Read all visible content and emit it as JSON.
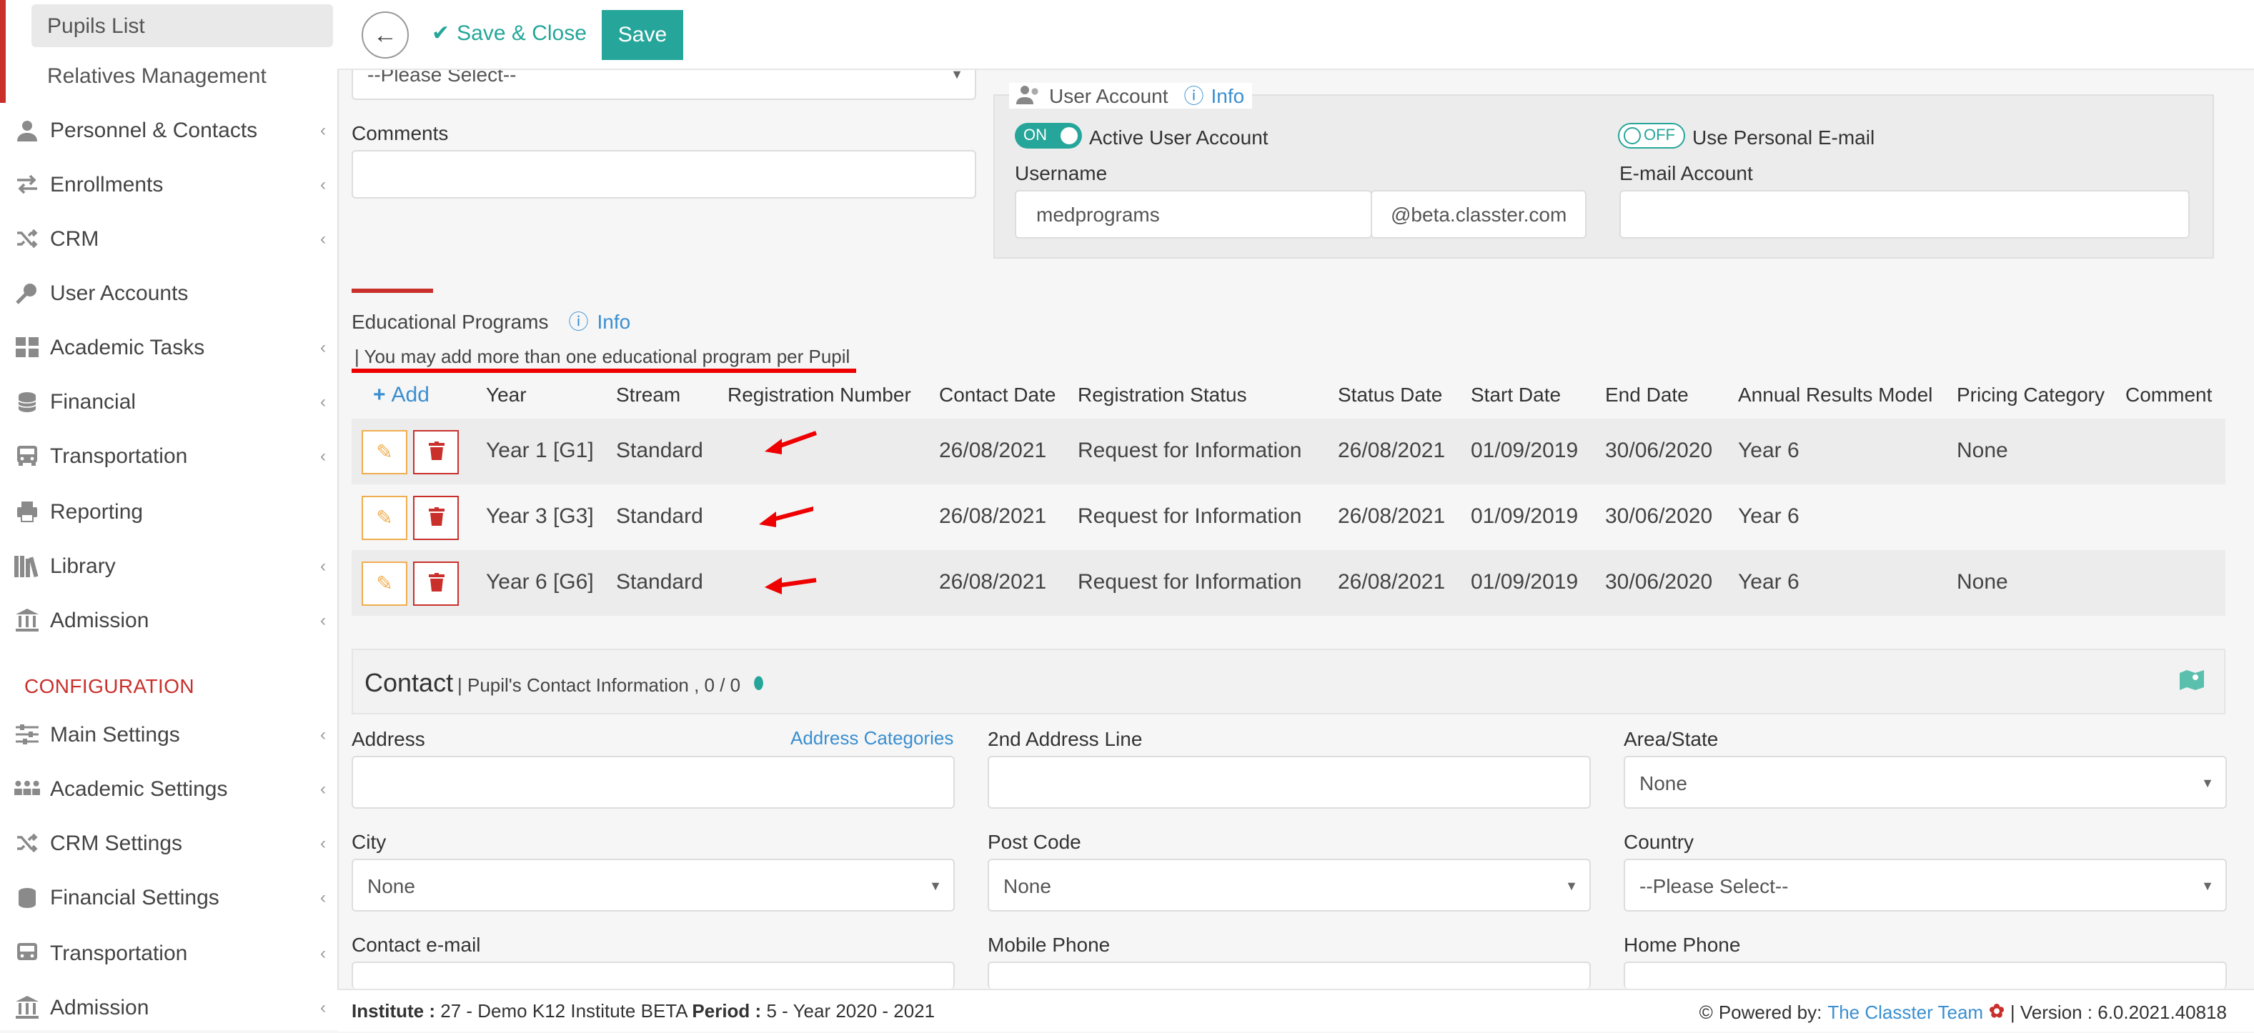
{
  "sidebar": {
    "sub_items": [
      "Pupils List",
      "Relatives Management"
    ],
    "items": [
      {
        "label": "Personnel & Contacts",
        "icon": "person-icon"
      },
      {
        "label": "Enrollments",
        "icon": "transfer-icon"
      },
      {
        "label": "CRM",
        "icon": "shuffle-icon"
      },
      {
        "label": "User Accounts",
        "icon": "key-icon"
      },
      {
        "label": "Academic Tasks",
        "icon": "grid-icon"
      },
      {
        "label": "Financial",
        "icon": "coins-icon"
      },
      {
        "label": "Transportation",
        "icon": "bus-icon"
      },
      {
        "label": "Reporting",
        "icon": "printer-icon"
      },
      {
        "label": "Library",
        "icon": "books-icon"
      },
      {
        "label": "Admission",
        "icon": "institution-icon"
      }
    ],
    "config_header": "CONFIGURATION",
    "config_items": [
      {
        "label": "Main Settings",
        "icon": "sliders-icon"
      },
      {
        "label": "Academic Settings",
        "icon": "group-icon"
      },
      {
        "label": "CRM Settings",
        "icon": "shuffle-icon"
      },
      {
        "label": "Financial Settings",
        "icon": "coins-icon"
      },
      {
        "label": "Transportation",
        "icon": "bus-icon"
      },
      {
        "label": "Admission",
        "icon": "institution-icon"
      }
    ]
  },
  "toolbar": {
    "save_close_label": "Save & Close",
    "save_label": "Save"
  },
  "form": {
    "top_select_value": "--Please Select--",
    "comments_label": "Comments",
    "comments_value": ""
  },
  "user_account": {
    "title": "User Account",
    "info_label": "Info",
    "active_toggle": "ON",
    "active_label": "Active User Account",
    "personal_toggle": "OFF",
    "personal_label": "Use Personal E-mail",
    "username_label": "Username",
    "username_value": "medprograms",
    "domain": "@beta.classter.com",
    "email_label": "E-mail Account",
    "email_value": ""
  },
  "programs": {
    "title": "Educational Programs",
    "info_label": "Info",
    "note": "| You may add more than one educational program per Pupil",
    "add_label": "Add",
    "columns": [
      "Year",
      "Stream",
      "Registration Number",
      "Contact Date",
      "Registration Status",
      "Status Date",
      "Start Date",
      "End Date",
      "Annual Results Model",
      "Pricing Category",
      "Comment"
    ],
    "rows": [
      [
        "Year 1 [G1]",
        "Standard",
        "",
        "26/08/2021",
        "Request for Information",
        "26/08/2021",
        "01/09/2019",
        "30/06/2020",
        "Year 6",
        "None",
        ""
      ],
      [
        "Year 3 [G3]",
        "Standard",
        "",
        "26/08/2021",
        "Request for Information",
        "26/08/2021",
        "01/09/2019",
        "30/06/2020",
        "Year 6",
        "",
        ""
      ],
      [
        "Year 6 [G6]",
        "Standard",
        "",
        "26/08/2021",
        "Request for Information",
        "26/08/2021",
        "01/09/2019",
        "30/06/2020",
        "Year 6",
        "None",
        ""
      ]
    ]
  },
  "contact": {
    "title": "Contact",
    "subtitle": "| Pupil's Contact Information , 0 / 0",
    "address_label": "Address",
    "address_categories_link": "Address Categories",
    "address2_label": "2nd Address Line",
    "area_label": "Area/State",
    "area_value": "None",
    "city_label": "City",
    "city_value": "None",
    "postcode_label": "Post Code",
    "postcode_value": "None",
    "country_label": "Country",
    "country_value": "--Please Select--",
    "contact_email_label": "Contact e-mail",
    "mobile_label": "Mobile Phone",
    "home_phone_label": "Home Phone"
  },
  "footer": {
    "institute_key": "Institute :",
    "institute_value": "27 - Demo K12 Institute BETA",
    "period_key": "Period :",
    "period_value": "5 - Year 2020 - 2021",
    "powered_by": "Powered by:",
    "team_link": "The Classter Team",
    "version": "| Version : 6.0.2021.40818"
  },
  "colors": {
    "accent": "#26a69a",
    "brand_red": "#c9302c",
    "link": "#3a8fd0",
    "edit_orange": "#f0ad4e"
  }
}
